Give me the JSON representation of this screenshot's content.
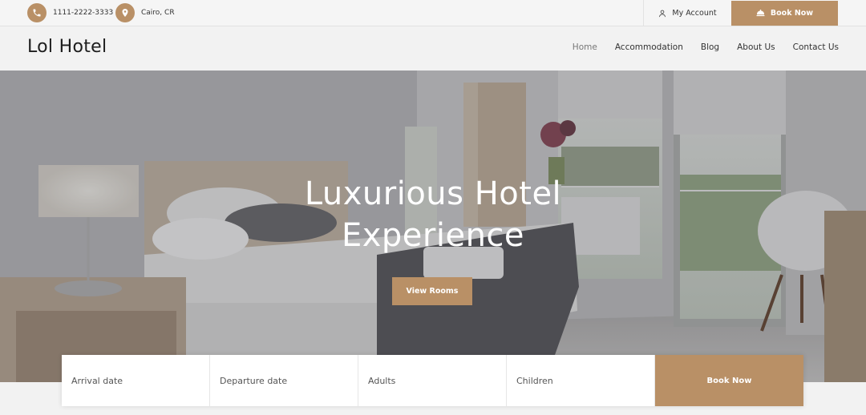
{
  "topbar": {
    "phone": "1111-2222-3333",
    "location": "Cairo, CR",
    "account_label": "My Account",
    "book_label": "Book Now",
    "phone_icon": "phone-icon",
    "location_icon": "map-pin-icon",
    "account_icon": "user-icon",
    "book_icon": "bell-icon"
  },
  "header": {
    "logo": "Lol Hotel",
    "nav": [
      "Home",
      "Accommodation",
      "Blog",
      "About Us",
      "Contact Us"
    ]
  },
  "hero": {
    "headline_line1": "Luxurious Hotel",
    "headline_line2": "Experience",
    "button_label": "View Rooms"
  },
  "booking": {
    "arrival": "Arrival date",
    "departure": "Departure date",
    "adults": "Adults",
    "children": "Children",
    "submit": "Book Now"
  },
  "colors": {
    "accent": "#b99066",
    "topbar_bg": "#f5f5f5",
    "header_bg": "#f2f2f2"
  }
}
